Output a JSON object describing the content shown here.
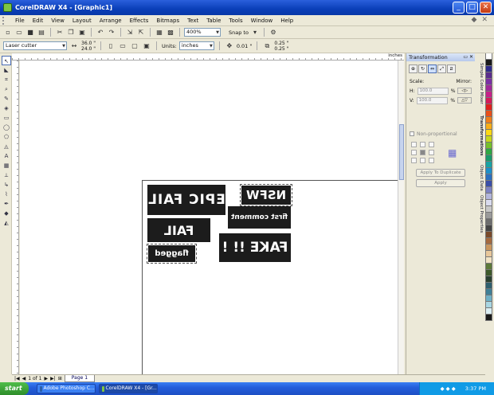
{
  "window": {
    "title": "CorelDRAW X4 - [Graphic1]"
  },
  "menu": [
    "File",
    "Edit",
    "View",
    "Layout",
    "Arrange",
    "Effects",
    "Bitmaps",
    "Text",
    "Table",
    "Tools",
    "Window",
    "Help"
  ],
  "toolbar": {
    "zoom": "400%",
    "snap_to": "Snap to"
  },
  "property_bar": {
    "paper_type": "Laser cutter",
    "width": "36.0 \"",
    "height": "24.0 \"",
    "units_label": "Units:",
    "units_value": "inches",
    "nudge": "0.01 \"",
    "dup_x": "0.25 \"",
    "dup_y": "0.25 \""
  },
  "ruler": {
    "unit": "inches"
  },
  "canvas": {
    "stickers": [
      "EPIC FAIL",
      "NSFW",
      "first comment",
      "FAIL",
      "FAKE !! !",
      "flagged"
    ]
  },
  "docker": {
    "title": "Transformation",
    "scale_label": "Scale:",
    "mirror_label": "Mirror:",
    "scale_x": "100.0",
    "scale_y": "100.0",
    "percent": "%",
    "nonprop_label": "Non-proportional",
    "apply_dup": "Apply To Duplicate",
    "apply": "Apply"
  },
  "side_tabs": [
    "Simple Color Mixer",
    "Transformations",
    "Object Data",
    "Object Properties"
  ],
  "palette_colors": [
    "#ffffff",
    "#1a1a1a",
    "#2e2a8a",
    "#5a2d8c",
    "#7a2fa5",
    "#a0289a",
    "#c6218a",
    "#d41b5a",
    "#e0201d",
    "#e8501b",
    "#f07e19",
    "#f7ad18",
    "#fdd714",
    "#c7d61a",
    "#75c02b",
    "#2ea843",
    "#1a9a6b",
    "#1aa3a3",
    "#1d8fc9",
    "#2a6fbf",
    "#3a4fa8",
    "#7d83c4",
    "#b3b6dc",
    "#d9dbee",
    "#c7c7c7",
    "#9a9a9a",
    "#6d6d6d",
    "#444444",
    "#7a4a2a",
    "#a56a3e",
    "#c9965d",
    "#e8c79a",
    "#f1e3c4",
    "#5d7a3a",
    "#3e5a2a",
    "#2a4030",
    "#2f5f6d",
    "#3f7f96",
    "#6fb0c6",
    "#a9d6e2",
    "#dbeef3",
    "#1a1a1a"
  ],
  "pagenav": {
    "counter": "1 of 1",
    "page_tab": "Page 1"
  },
  "taskbar": {
    "start": "start",
    "tasks": [
      "Adobe Photoshop C...",
      "CorelDRAW X4 - [Gr..."
    ],
    "clock": "3:37 PM"
  }
}
